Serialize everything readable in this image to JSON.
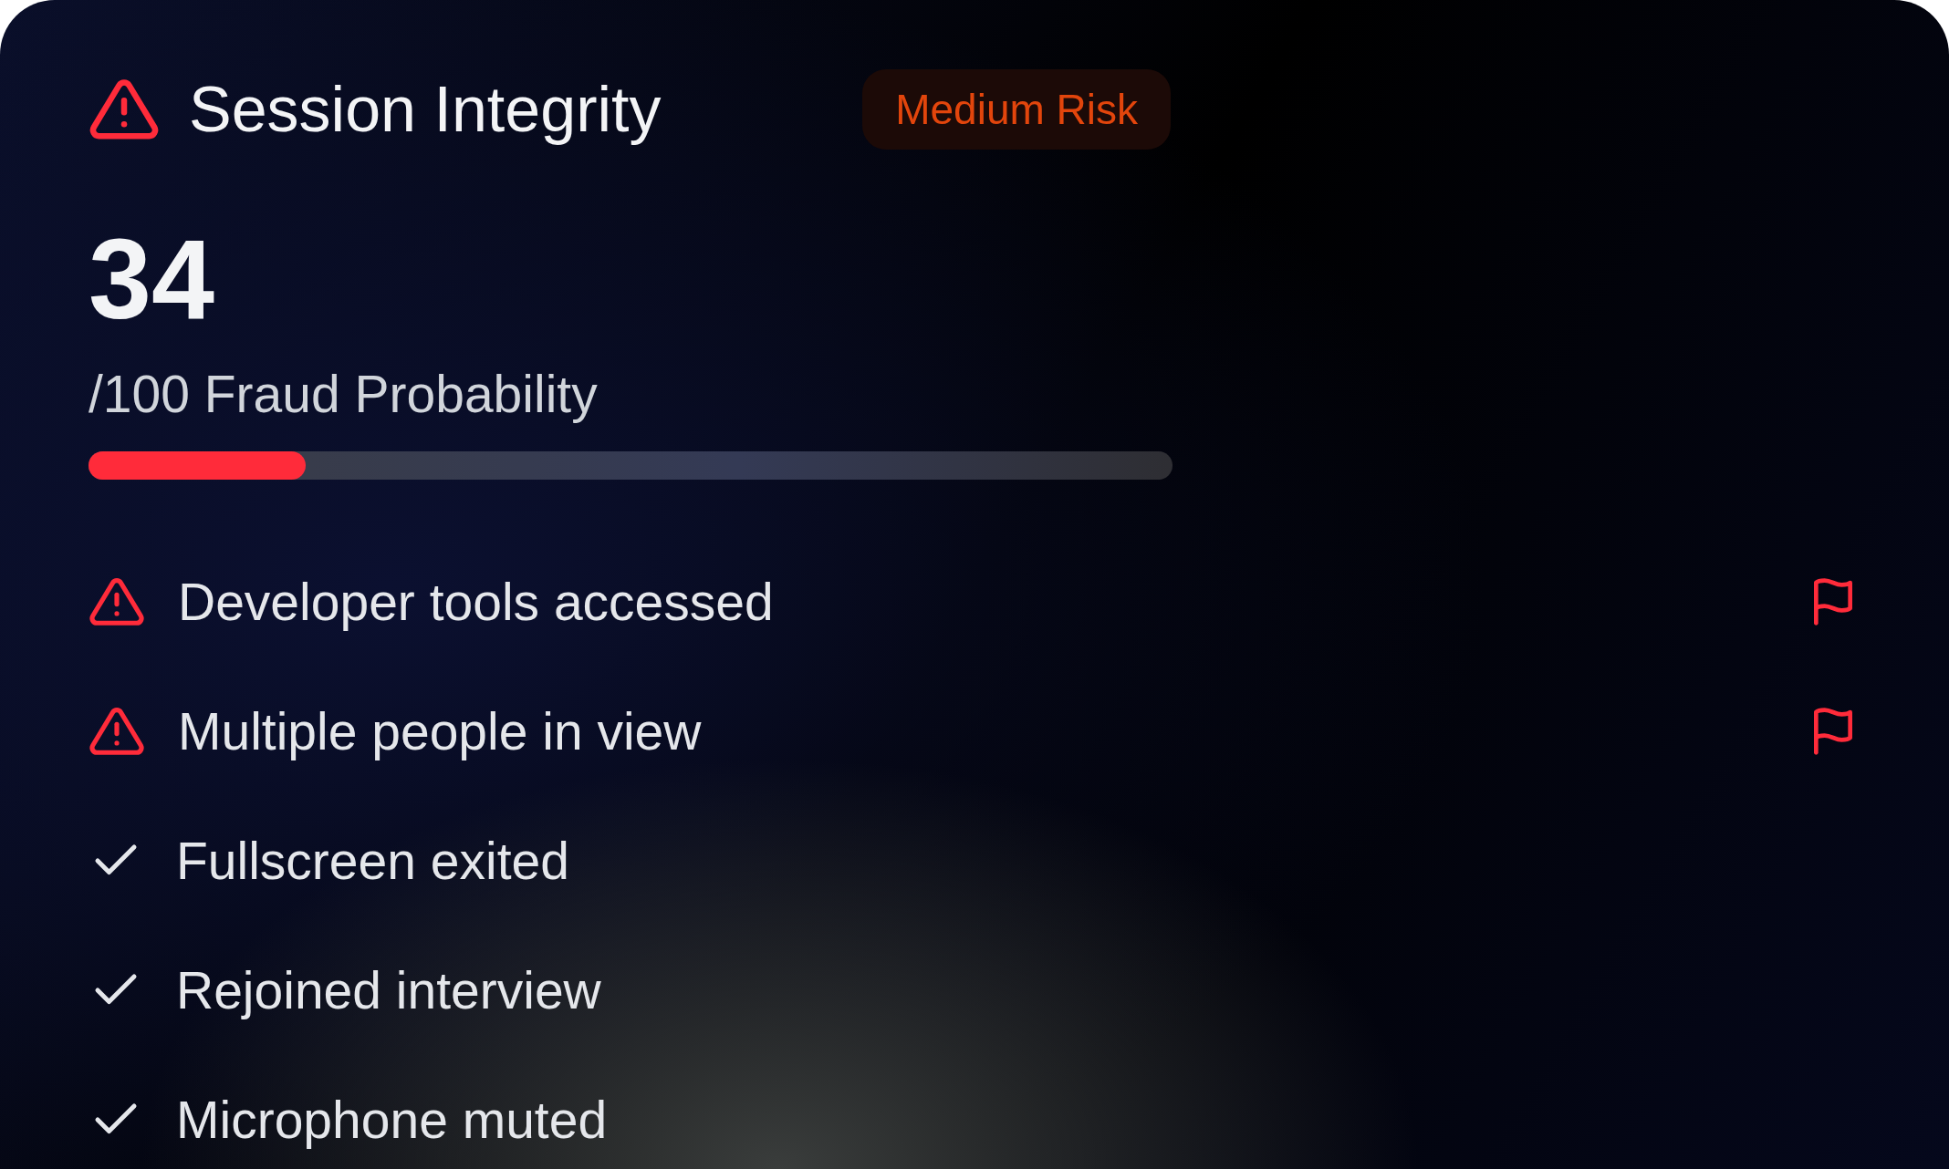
{
  "header": {
    "title": "Session Integrity",
    "badge": "Medium Risk"
  },
  "score": {
    "value": "34",
    "caption": "/100 Fraud Probability",
    "level": 0.2
  },
  "events": [
    {
      "kind": "alert",
      "label": "Developer tools accessed",
      "flagged": true
    },
    {
      "kind": "alert",
      "label": "Multiple people in view",
      "flagged": true
    },
    {
      "kind": "check",
      "label": "Fullscreen exited",
      "flagged": false
    },
    {
      "kind": "check",
      "label": "Rejoined interview",
      "flagged": false
    },
    {
      "kind": "check",
      "label": "Microphone muted",
      "flagged": false
    }
  ]
}
